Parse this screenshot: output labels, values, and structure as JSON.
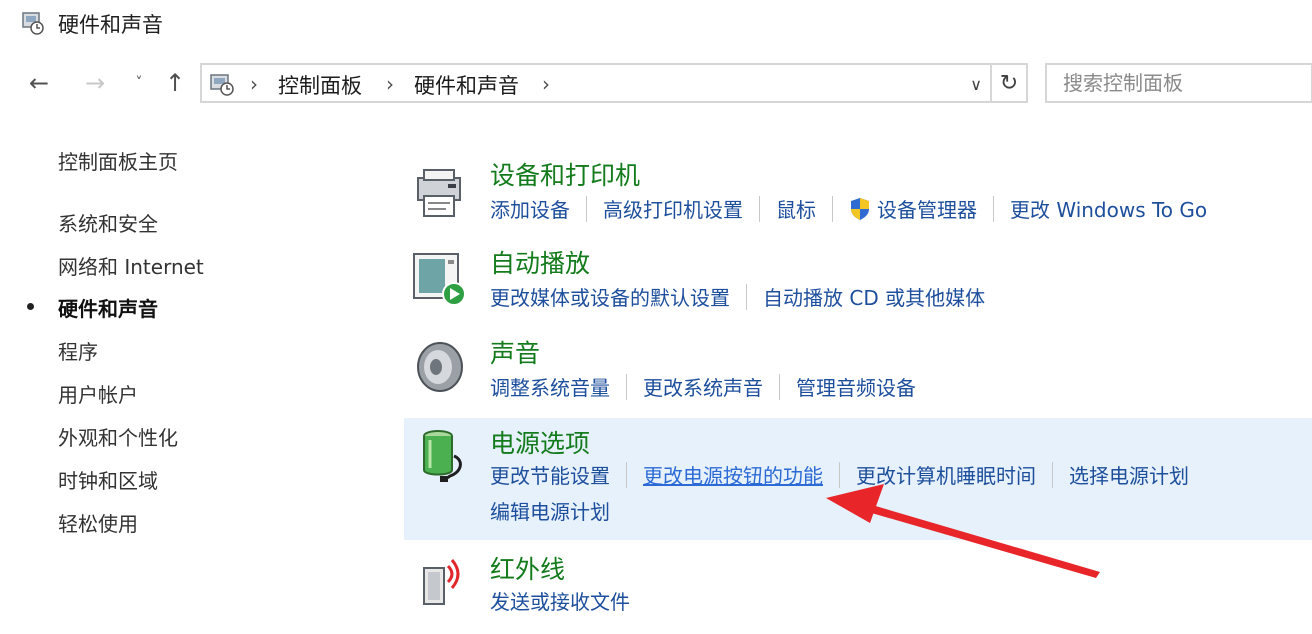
{
  "window": {
    "title": "硬件和声音"
  },
  "nav": {
    "back": "←",
    "forward": "→",
    "recent": "˅",
    "up": "↑",
    "breadcrumb": [
      "控制面板",
      "硬件和声音"
    ],
    "sep": "›",
    "dropdown": "∨",
    "refresh": "↻",
    "search_placeholder": "搜索控制面板"
  },
  "sidebar": {
    "home": "控制面板主页",
    "items": [
      {
        "label": "系统和安全",
        "current": false
      },
      {
        "label": "网络和 Internet",
        "current": false
      },
      {
        "label": "硬件和声音",
        "current": true
      },
      {
        "label": "程序",
        "current": false
      },
      {
        "label": "用户帐户",
        "current": false
      },
      {
        "label": "外观和个性化",
        "current": false
      },
      {
        "label": "时钟和区域",
        "current": false
      },
      {
        "label": "轻松使用",
        "current": false
      }
    ]
  },
  "categories": [
    {
      "title": "设备和打印机",
      "icon": "printer-icon",
      "links": [
        "添加设备",
        "高级打印机设置",
        "鼠标",
        "设备管理器",
        "更改 Windows To Go"
      ]
    },
    {
      "title": "自动播放",
      "icon": "autoplay-icon",
      "links": [
        "更改媒体或设备的默认设置",
        "自动播放 CD 或其他媒体"
      ]
    },
    {
      "title": "声音",
      "icon": "speaker-icon",
      "links": [
        "调整系统音量",
        "更改系统声音",
        "管理音频设备"
      ]
    },
    {
      "title": "电源选项",
      "icon": "battery-icon",
      "links": [
        "更改节能设置",
        "更改电源按钮的功能",
        "更改计算机睡眠时间",
        "选择电源计划"
      ],
      "links2": [
        "编辑电源计划"
      ]
    },
    {
      "title": "红外线",
      "icon": "infrared-icon",
      "links": [
        "发送或接收文件"
      ]
    }
  ],
  "colors": {
    "category_title": "#137b1c",
    "link": "#1e4f9d",
    "highlight_bg": "#e6f1fb",
    "arrow": "#e8262a"
  }
}
